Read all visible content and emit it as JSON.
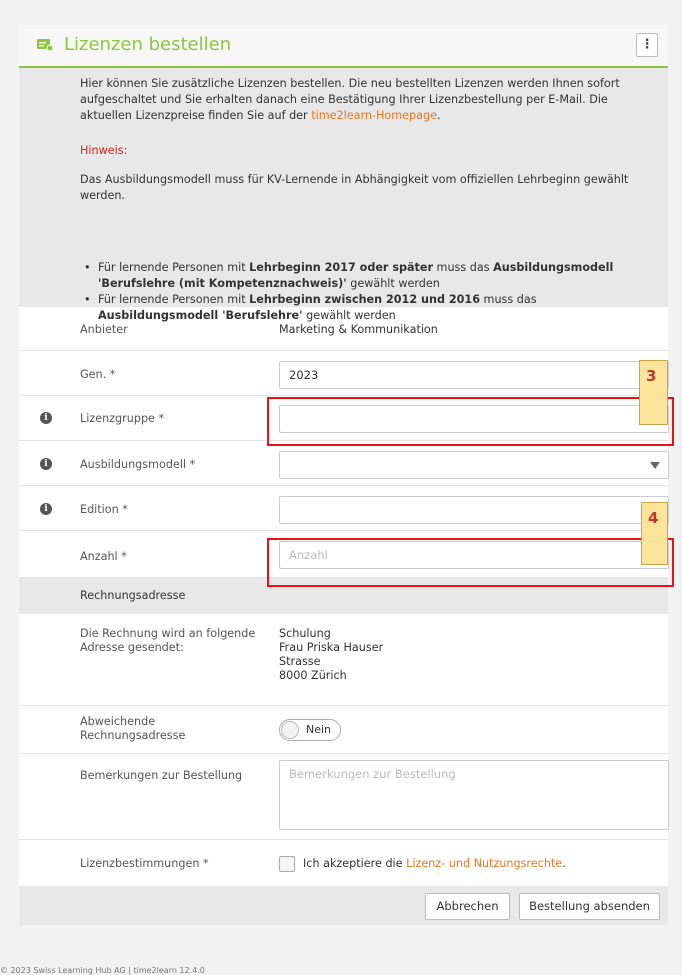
{
  "header": {
    "title": "Lizenzen bestellen",
    "menu_icon": "kebab-vertical-icon",
    "menu_label": "⋮"
  },
  "info": {
    "text_before_link": "Hier können Sie zusätzliche Lizenzen bestellen. Die neu bestellten Lizenzen werden Ihnen sofort aufgeschaltet und Sie erhalten danach eine Bestätigung Ihrer Lizenzbestellung per E-Mail. Die aktuellen Lizenzpreise finden Sie auf der ",
    "link": "time2learn-Homepage",
    "text_after_link": ".",
    "hint_label": "Hinweis:",
    "hint_text": "Das Ausbildungsmodell muss für KV-Lernende in Abhängigkeit vom offiziellen Lehrbeginn gewählt werden.",
    "bullet1": {
      "a": "Für lernende Personen mit ",
      "b": "Lehrbeginn 2017 oder später",
      "c": " muss das ",
      "d": "Ausbildungsmodell 'Berufslehre (mit Kompetenznachweis)'",
      "e": " gewählt werden"
    },
    "bullet2": {
      "a": "Für lernende Personen mit ",
      "b": "Lehrbeginn zwischen 2012 und 2016",
      "c": " muss das ",
      "d": "Ausbildungsmodell 'Berufslehre'",
      "e": " gewählt werden"
    }
  },
  "form": {
    "anbieter_label": "Anbieter",
    "anbieter_value": "Marketing & Kommunikation",
    "gen_label": "Gen. *",
    "gen_value": "2023",
    "lizenzgruppe_label": "Lizenzgruppe *",
    "lizenzgruppe_value": "",
    "ausbildungsmodell_label": "Ausbildungsmodell *",
    "ausbildungsmodell_value": "",
    "edition_label": "Edition *",
    "edition_value": "",
    "anzahl_label": "Anzahl *",
    "anzahl_placeholder": "Anzahl",
    "rechnungsadresse_heading": "Rechnungsadresse",
    "address_label": "Die Rechnung wird an folgende Adresse gesendet:",
    "address_lines": [
      "Schulung",
      "Frau Priska Hauser",
      "Strasse",
      "8000 Zürich"
    ],
    "abweichend_label": "Abweichende Rechnungsadresse",
    "toggle_value": "Nein",
    "bemerkungen_label": "Bemerkungen zur Bestellung",
    "bemerkungen_placeholder": "Bemerkungen zur Bestellung",
    "lizenzbestimmungen_label": "Lizenzbestimmungen *",
    "accept_text": "Ich akzeptiere die ",
    "accept_link": "Lizenz- und Nutzungsrechte",
    "accept_end": "."
  },
  "buttons": {
    "cancel": "Abbrechen",
    "submit": "Bestellung absenden"
  },
  "callouts": {
    "c3": "3",
    "c4": "4"
  },
  "footer": "© 2023 Swiss Learning Hub AG | time2learn 12.4.0",
  "colors": {
    "accent": "#8cc63f",
    "link": "#e8761e",
    "hint": "#d9261c",
    "highlight": "#ee1111"
  }
}
